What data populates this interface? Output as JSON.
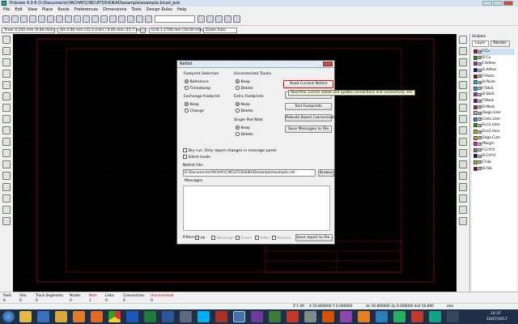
{
  "window": {
    "title": "Pcbnew 4.0.6 D:\\Documents\\YACHAY\\CIRCUITOS\\KIKAD\\example\\example.kicad_pcb"
  },
  "menubar": {
    "items": [
      "File",
      "Edit",
      "View",
      "Place",
      "Route",
      "Preferences",
      "Dimensions",
      "Tools",
      "Design Rules",
      "Help"
    ]
  },
  "toolbar2": {
    "track": "Track 0.250 mm (9.84 mils) *",
    "via": "Via 0.80 mm (31.5 mils) / 0.40 mm (15.7 mils) *",
    "grid": "Grid 1.2700 mm (50.00 mils)",
    "zoom": "Zoom Auto"
  },
  "layers": {
    "header": "Visibles",
    "tab_layer": "Layer",
    "tab_render": "Render",
    "items": [
      {
        "name": "F.Cu",
        "color": "#c00000"
      },
      {
        "name": "B.Cu",
        "color": "#00a000"
      },
      {
        "name": "F.Adhes",
        "color": "#8a2be2"
      },
      {
        "name": "B.Adhes",
        "color": "#0000c0"
      },
      {
        "name": "F.Paste",
        "color": "#8b0000"
      },
      {
        "name": "B.Paste",
        "color": "#00bfff"
      },
      {
        "name": "F.SilkS",
        "color": "#00bfbf"
      },
      {
        "name": "B.SilkS",
        "color": "#a020f0"
      },
      {
        "name": "F.Mask",
        "color": "#800080"
      },
      {
        "name": "B.Mask",
        "color": "#a52a2a"
      },
      {
        "name": "Dwgs.User",
        "color": "#c0c0c0"
      },
      {
        "name": "Cmts.User",
        "color": "#1e90ff"
      },
      {
        "name": "Eco1.User",
        "color": "#00a000"
      },
      {
        "name": "Eco2.User",
        "color": "#c0c000"
      },
      {
        "name": "Edge.Cuts",
        "color": "#c0c000"
      },
      {
        "name": "Margin",
        "color": "#ff00ff"
      },
      {
        "name": "F.CrtYd",
        "color": "#808080"
      },
      {
        "name": "B.CrtYd",
        "color": "#000080"
      },
      {
        "name": "F.Fab",
        "color": "#c0c000"
      },
      {
        "name": "B.Fab",
        "color": "#8b0000"
      }
    ]
  },
  "statusbar": {
    "labels": [
      "Pads",
      "Vias",
      "Track Segments",
      "Nodes",
      "Nets",
      "Links",
      "Connections",
      "Unconnected"
    ],
    "values": [
      "0",
      "0",
      "0",
      "0",
      "1",
      "0",
      "0",
      "0"
    ],
    "zoom": "Z 1.09",
    "xy": "X 50.800000  Y 0.000000",
    "dxdy": "dx 50.800000  dy 0.000000  dist 50.800",
    "units": "mm"
  },
  "taskbar": {
    "time": "14:37",
    "date": "16/07/2017"
  },
  "dialog": {
    "title": "Netlist",
    "footprint_selection": "Footprint Selection",
    "fs_reference": "Reference",
    "fs_timestamp": "Timestamp",
    "exchange_footprint": "Exchange Footprint",
    "ef_keep": "Keep",
    "ef_change": "Change",
    "unconnected_tracks": "Unconnected Tracks",
    "ut_keep": "Keep",
    "ut_delete": "Delete",
    "extra_footprints": "Extra Footprints",
    "xf_keep": "Keep",
    "xf_delete": "Delete",
    "single_pad_nets": "Single Pad Nets",
    "sp_keep": "Keep",
    "sp_delete": "Delete",
    "btn_read": "Read Current Netlist",
    "btn_close": "Close",
    "btn_test": "Test Footprints",
    "btn_rebuild": "Rebuild Board Connectivity",
    "btn_save": "Save Messages to File",
    "dry_run": "Dry run. Only report changes in message panel",
    "silent_mode": "Silent mode",
    "netlist_file_label": "Netlist File:",
    "netlist_file": "D:\\Documents\\YACHAY\\CIRCUITOS\\KIKAD\\example\\example.net",
    "browse": "Browse",
    "messages_label": "Messages",
    "filters": "Filters:",
    "f_all": "All",
    "f_warnings": "Warnings",
    "f_errors": "Errors",
    "f_infos": "Infos",
    "f_actions": "Actions",
    "save_report": "Save report to file..."
  },
  "tooltip": "Read the current netlist and update connections and connectivity info"
}
